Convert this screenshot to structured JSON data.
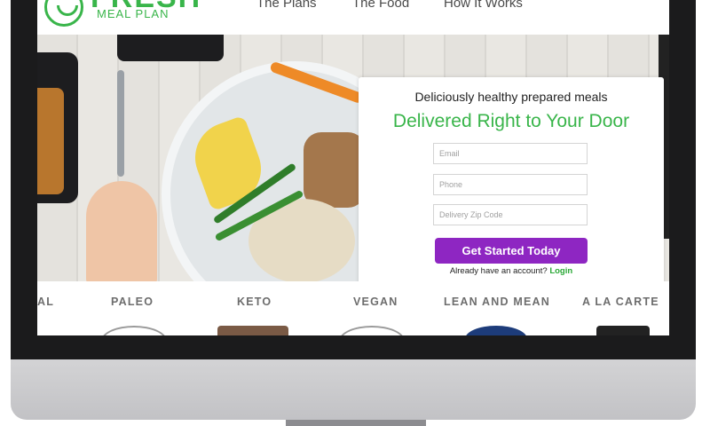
{
  "logo": {
    "brand": "FRESH",
    "tagline": "MEAL PLAN"
  },
  "nav": {
    "items": [
      {
        "label": "The Plans"
      },
      {
        "label": "The Food"
      },
      {
        "label": "How It Works"
      }
    ]
  },
  "signup": {
    "tagline": "Deliciously healthy prepared meals",
    "headline": "Delivered Right to Your Door",
    "email_placeholder": "Email",
    "phone_placeholder": "Phone",
    "zip_placeholder": "Delivery Zip Code",
    "cta_label": "Get Started Today",
    "login_prompt": "Already have an account?",
    "login_link": "Login",
    "rating_stars": "★★★★★"
  },
  "categories": [
    {
      "label": "AL"
    },
    {
      "label": "PALEO"
    },
    {
      "label": "KETO"
    },
    {
      "label": "VEGAN"
    },
    {
      "label": "LEAN AND MEAN"
    },
    {
      "label": "A LA CARTE"
    }
  ],
  "colors": {
    "brand_green": "#39b54a",
    "cta_purple": "#8e26c2",
    "star_gold": "#f2b705"
  }
}
